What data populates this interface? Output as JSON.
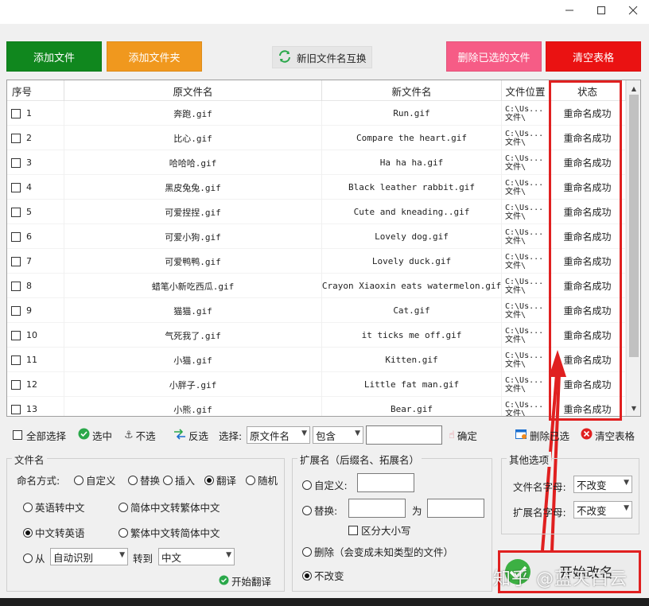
{
  "colors": {
    "add_file": "#10871e",
    "add_folder": "#f0981e",
    "delete_selected": "#f65c86",
    "clear_table": "#ea1212",
    "highlight": "#e02020"
  },
  "toolbar": {
    "add_file": "添加文件",
    "add_folder": "添加文件夹",
    "swap_names": "新旧文件名互换",
    "delete_selected": "删除已选的文件",
    "clear_table": "清空表格"
  },
  "table": {
    "headers": {
      "seq": "序号",
      "original": "原文件名",
      "new": "新文件名",
      "location": "文件位置",
      "status": "状态"
    },
    "rows": [
      {
        "seq": "1",
        "original": "奔跑.gif",
        "new": "Run.gif",
        "loc1": "C:\\Us...",
        "loc2": "文件\\",
        "status": "重命名成功"
      },
      {
        "seq": "2",
        "original": "比心.gif",
        "new": "Compare the heart.gif",
        "loc1": "C:\\Us...",
        "loc2": "文件\\",
        "status": "重命名成功"
      },
      {
        "seq": "3",
        "original": "哈哈哈.gif",
        "new": "Ha ha ha.gif",
        "loc1": "C:\\Us...",
        "loc2": "文件\\",
        "status": "重命名成功"
      },
      {
        "seq": "4",
        "original": "黑皮兔兔.gif",
        "new": "Black leather rabbit.gif",
        "loc1": "C:\\Us...",
        "loc2": "文件\\",
        "status": "重命名成功"
      },
      {
        "seq": "5",
        "original": "可爱捏捏.gif",
        "new": "Cute and kneading..gif",
        "loc1": "C:\\Us...",
        "loc2": "文件\\",
        "status": "重命名成功"
      },
      {
        "seq": "6",
        "original": "可爱小狗.gif",
        "new": "Lovely dog.gif",
        "loc1": "C:\\Us...",
        "loc2": "文件\\",
        "status": "重命名成功"
      },
      {
        "seq": "7",
        "original": "可爱鸭鸭.gif",
        "new": "Lovely duck.gif",
        "loc1": "C:\\Us...",
        "loc2": "文件\\",
        "status": "重命名成功"
      },
      {
        "seq": "8",
        "original": "蜡笔小新吃西瓜.gif",
        "new": "Crayon Xiaoxin eats watermelon.gif",
        "loc1": "C:\\Us...",
        "loc2": "文件\\",
        "status": "重命名成功"
      },
      {
        "seq": "9",
        "original": "猫猫.gif",
        "new": "Cat.gif",
        "loc1": "C:\\Us...",
        "loc2": "文件\\",
        "status": "重命名成功"
      },
      {
        "seq": "10",
        "original": "气死我了.gif",
        "new": "it ticks me off.gif",
        "loc1": "C:\\Us...",
        "loc2": "文件\\",
        "status": "重命名成功"
      },
      {
        "seq": "11",
        "original": "小猫.gif",
        "new": "Kitten.gif",
        "loc1": "C:\\Us...",
        "loc2": "文件\\",
        "status": "重命名成功"
      },
      {
        "seq": "12",
        "original": "小胖子.gif",
        "new": "Little fat man.gif",
        "loc1": "C:\\Us...",
        "loc2": "文件\\",
        "status": "重命名成功"
      },
      {
        "seq": "13",
        "original": "小熊.gif",
        "new": "Bear.gif",
        "loc1": "C:\\Us...",
        "loc2": "文件\\",
        "status": "重命名成功"
      }
    ]
  },
  "selbar": {
    "select_all": "全部选择",
    "select": "选中",
    "deselect": "不选",
    "invert": "反选",
    "choose_label": "选择:",
    "field_value": "原文件名",
    "match_value": "包含",
    "confirm": "确定",
    "delete_selected": "删除已选",
    "clear_table": "清空表格"
  },
  "filename_group": {
    "legend": "文件名",
    "naming_label": "命名方式:",
    "modes": [
      "自定义",
      "替换",
      "插入",
      "翻译",
      "随机"
    ],
    "selected_mode": "翻译",
    "options": [
      "英语转中文",
      "简体中文转繁体中文",
      "中文转英语",
      "繁体中文转简体中文"
    ],
    "selected_option": "中文转英语",
    "from_label": "从",
    "from_value": "自动识别",
    "to_label": "转到",
    "to_value": "中文",
    "start_translate": "开始翻译"
  },
  "ext_group": {
    "legend": "扩展名（后缀名、拓展名）",
    "custom": "自定义:",
    "replace": "替换:",
    "to_word": "为",
    "case_sensitive": "区分大小写",
    "delete": "删除（会变成未知类型的文件）",
    "no_change": "不改变"
  },
  "other_group": {
    "legend": "其他选项",
    "fname_case_label": "文件名字母:",
    "fname_case_value": "不改变",
    "ext_case_label": "扩展名字母:",
    "ext_case_value": "不改变"
  },
  "start_rename": "开始改名",
  "watermark": "知乎 @蓝天白云"
}
